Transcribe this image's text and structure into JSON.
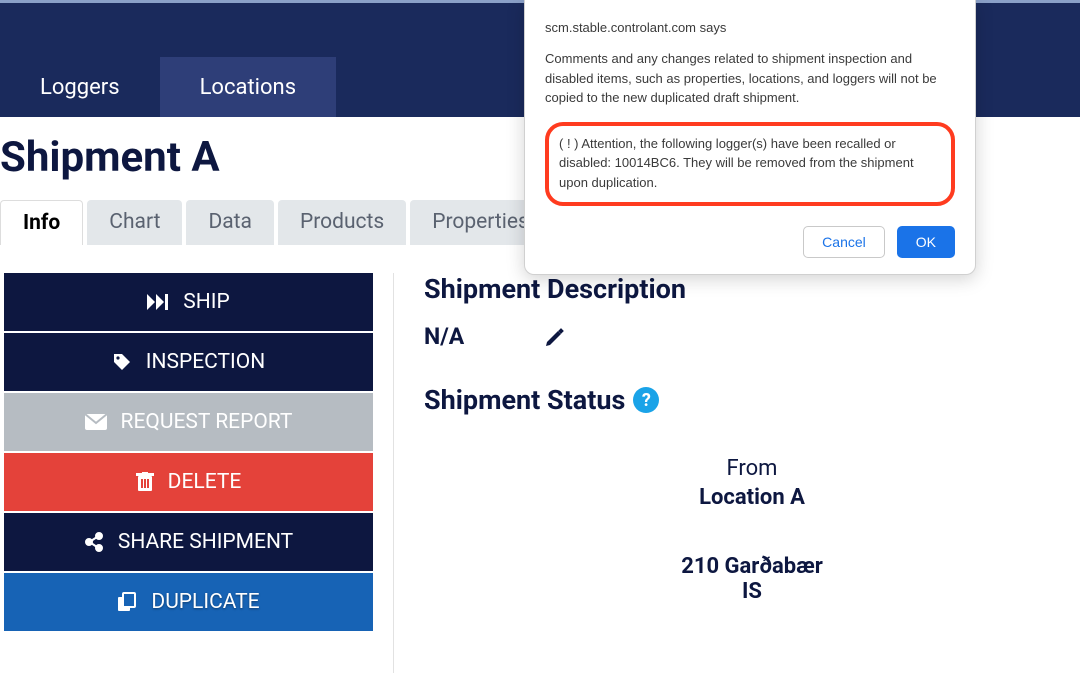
{
  "topnav": {
    "loggers": "Loggers",
    "locations": "Locations"
  },
  "page_title": "Shipment A",
  "tabs": {
    "info": "Info",
    "chart": "Chart",
    "data": "Data",
    "products": "Products",
    "properties": "Properties"
  },
  "actions": {
    "ship": "SHIP",
    "inspection": "INSPECTION",
    "request_report": "REQUEST REPORT",
    "delete": "DELETE",
    "share": "SHARE SHIPMENT",
    "duplicate": "DUPLICATE"
  },
  "description": {
    "heading": "Shipment Description",
    "value": "N/A"
  },
  "status": {
    "heading": "Shipment Status",
    "from_label": "From",
    "from_location": "Location A",
    "from_address": "210 Garðabær",
    "from_country": "IS"
  },
  "dialog": {
    "source": "scm.stable.controlant.com says",
    "message1": "Comments and any changes related to shipment inspection and disabled items, such as properties, locations, and loggers will not be copied to the new duplicated draft shipment.",
    "message2": "( ! ) Attention, the following logger(s) have been recalled or disabled: 10014BC6. They will be removed from the shipment upon duplication.",
    "cancel": "Cancel",
    "ok": "OK"
  },
  "help_glyph": "?"
}
